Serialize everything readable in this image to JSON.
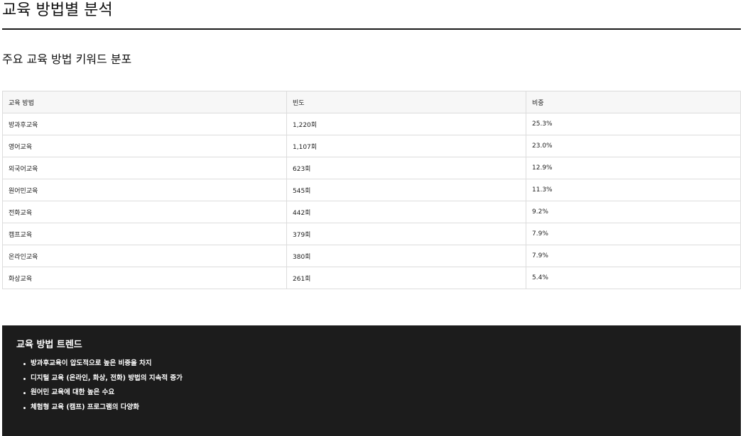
{
  "page": {
    "title": "교육 방법별 분석"
  },
  "section": {
    "title": "주요 교육 방법 키워드 분포"
  },
  "table": {
    "headers": [
      "교육 방법",
      "빈도",
      "비중"
    ],
    "rows": [
      [
        "방과후교육",
        "1,220회",
        "25.3%"
      ],
      [
        "영어교육",
        "1,107회",
        "23.0%"
      ],
      [
        "외국어교육",
        "623회",
        "12.9%"
      ],
      [
        "원어민교육",
        "545회",
        "11.3%"
      ],
      [
        "전화교육",
        "442회",
        "9.2%"
      ],
      [
        "캠프교육",
        "379회",
        "7.9%"
      ],
      [
        "온라인교육",
        "380회",
        "7.9%"
      ],
      [
        "화상교육",
        "261회",
        "5.4%"
      ]
    ]
  },
  "trend": {
    "title": "교육 방법 트렌드",
    "items": [
      "방과후교육이 압도적으로 높은 비중을 차지",
      "디지털 교육 (온라인, 화상, 전화) 방법의 지속적 증가",
      "원어민 교육에 대한 높은 수요",
      "체험형 교육 (캠프) 프로그램의 다양화"
    ]
  },
  "colors": {
    "trend_background": "#1c1c1c",
    "divider": "#1a1a1a",
    "table_border": "#dcdcdc",
    "table_header_bg": "#f7f7f7"
  }
}
